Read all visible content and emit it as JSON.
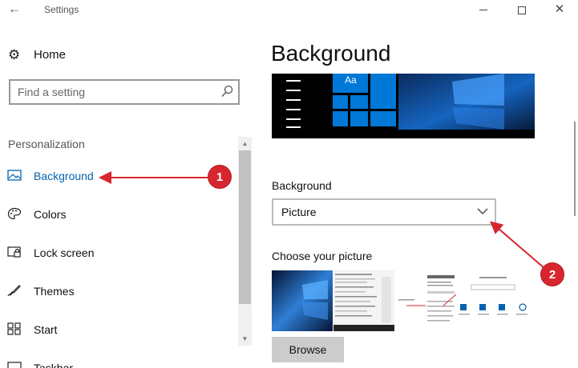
{
  "window": {
    "title": "Settings",
    "back_glyph": "←",
    "close_glyph": "✕"
  },
  "sidebar": {
    "home_label": "Home",
    "search_placeholder": "Find a setting",
    "section_label": "Personalization",
    "items": [
      {
        "label": "Background",
        "icon": "picture-icon",
        "active": true
      },
      {
        "label": "Colors",
        "icon": "palette-icon",
        "active": false
      },
      {
        "label": "Lock screen",
        "icon": "lock-screen-icon",
        "active": false
      },
      {
        "label": "Themes",
        "icon": "brush-icon",
        "active": false
      },
      {
        "label": "Start",
        "icon": "start-grid-icon",
        "active": false
      },
      {
        "label": "Taskbar",
        "icon": "taskbar-icon",
        "active": false
      }
    ]
  },
  "main": {
    "title": "Background",
    "tile_text": "Aa",
    "background_label": "Background",
    "background_value": "Picture",
    "choose_label": "Choose your picture",
    "browse_label": "Browse",
    "thumbnails": [
      {
        "name": "windows-hero-wallpaper"
      },
      {
        "name": "document-screenshot"
      },
      {
        "name": "windows-defender-screenshot"
      },
      {
        "name": "windows-settings-screenshot"
      }
    ]
  },
  "annotations": [
    {
      "number": "1"
    },
    {
      "number": "2"
    }
  ],
  "colors": {
    "accent": "#0063b1",
    "annotation_red": "#d7262e",
    "tile_blue": "#0078d7"
  }
}
